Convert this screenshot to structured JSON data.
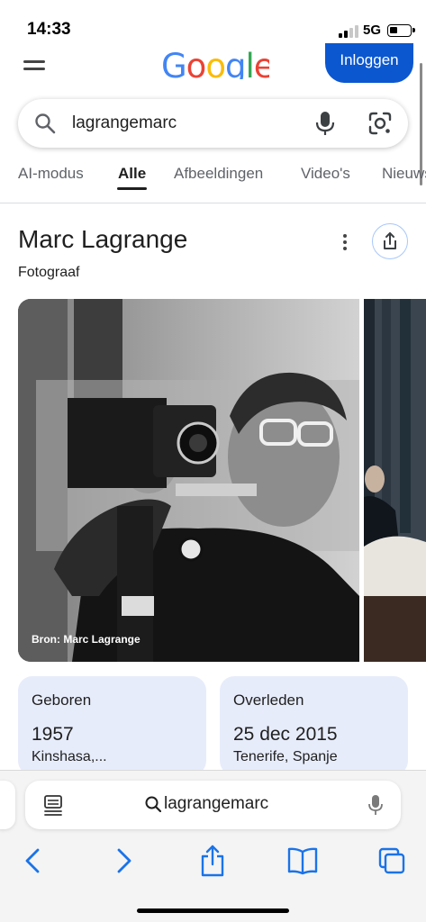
{
  "status_bar": {
    "time": "14:33",
    "network": "5G"
  },
  "header": {
    "logo_text": [
      "G",
      "o",
      "o",
      "g",
      "l",
      "e"
    ],
    "logo_colors": [
      "#4285f4",
      "#ea4335",
      "#fbbc05",
      "#4285f4",
      "#34a853",
      "#ea4335"
    ],
    "login_label": "Inloggen"
  },
  "search": {
    "query": "lagrangemarc"
  },
  "tabs": [
    {
      "label": "AI-modus",
      "active": false
    },
    {
      "label": "Alle",
      "active": true
    },
    {
      "label": "Afbeeldingen",
      "active": false
    },
    {
      "label": "Video's",
      "active": false
    },
    {
      "label": "Nieuws",
      "active": false
    }
  ],
  "knowledge_panel": {
    "title": "Marc Lagrange",
    "subtitle": "Fotograaf",
    "image_caption": "Bron: Marc Lagrange",
    "facts": [
      {
        "label": "Geboren",
        "value": "1957",
        "place": "Kinshasa,..."
      },
      {
        "label": "Overleden",
        "value": "25 dec 2015",
        "place": "Tenerife, Spanje"
      }
    ]
  },
  "browser": {
    "address_text": "lagrangemarc"
  },
  "colors": {
    "accent": "#0b57d0",
    "card_bg": "#e7ecfb",
    "ios_blue": "#1a73e8"
  }
}
